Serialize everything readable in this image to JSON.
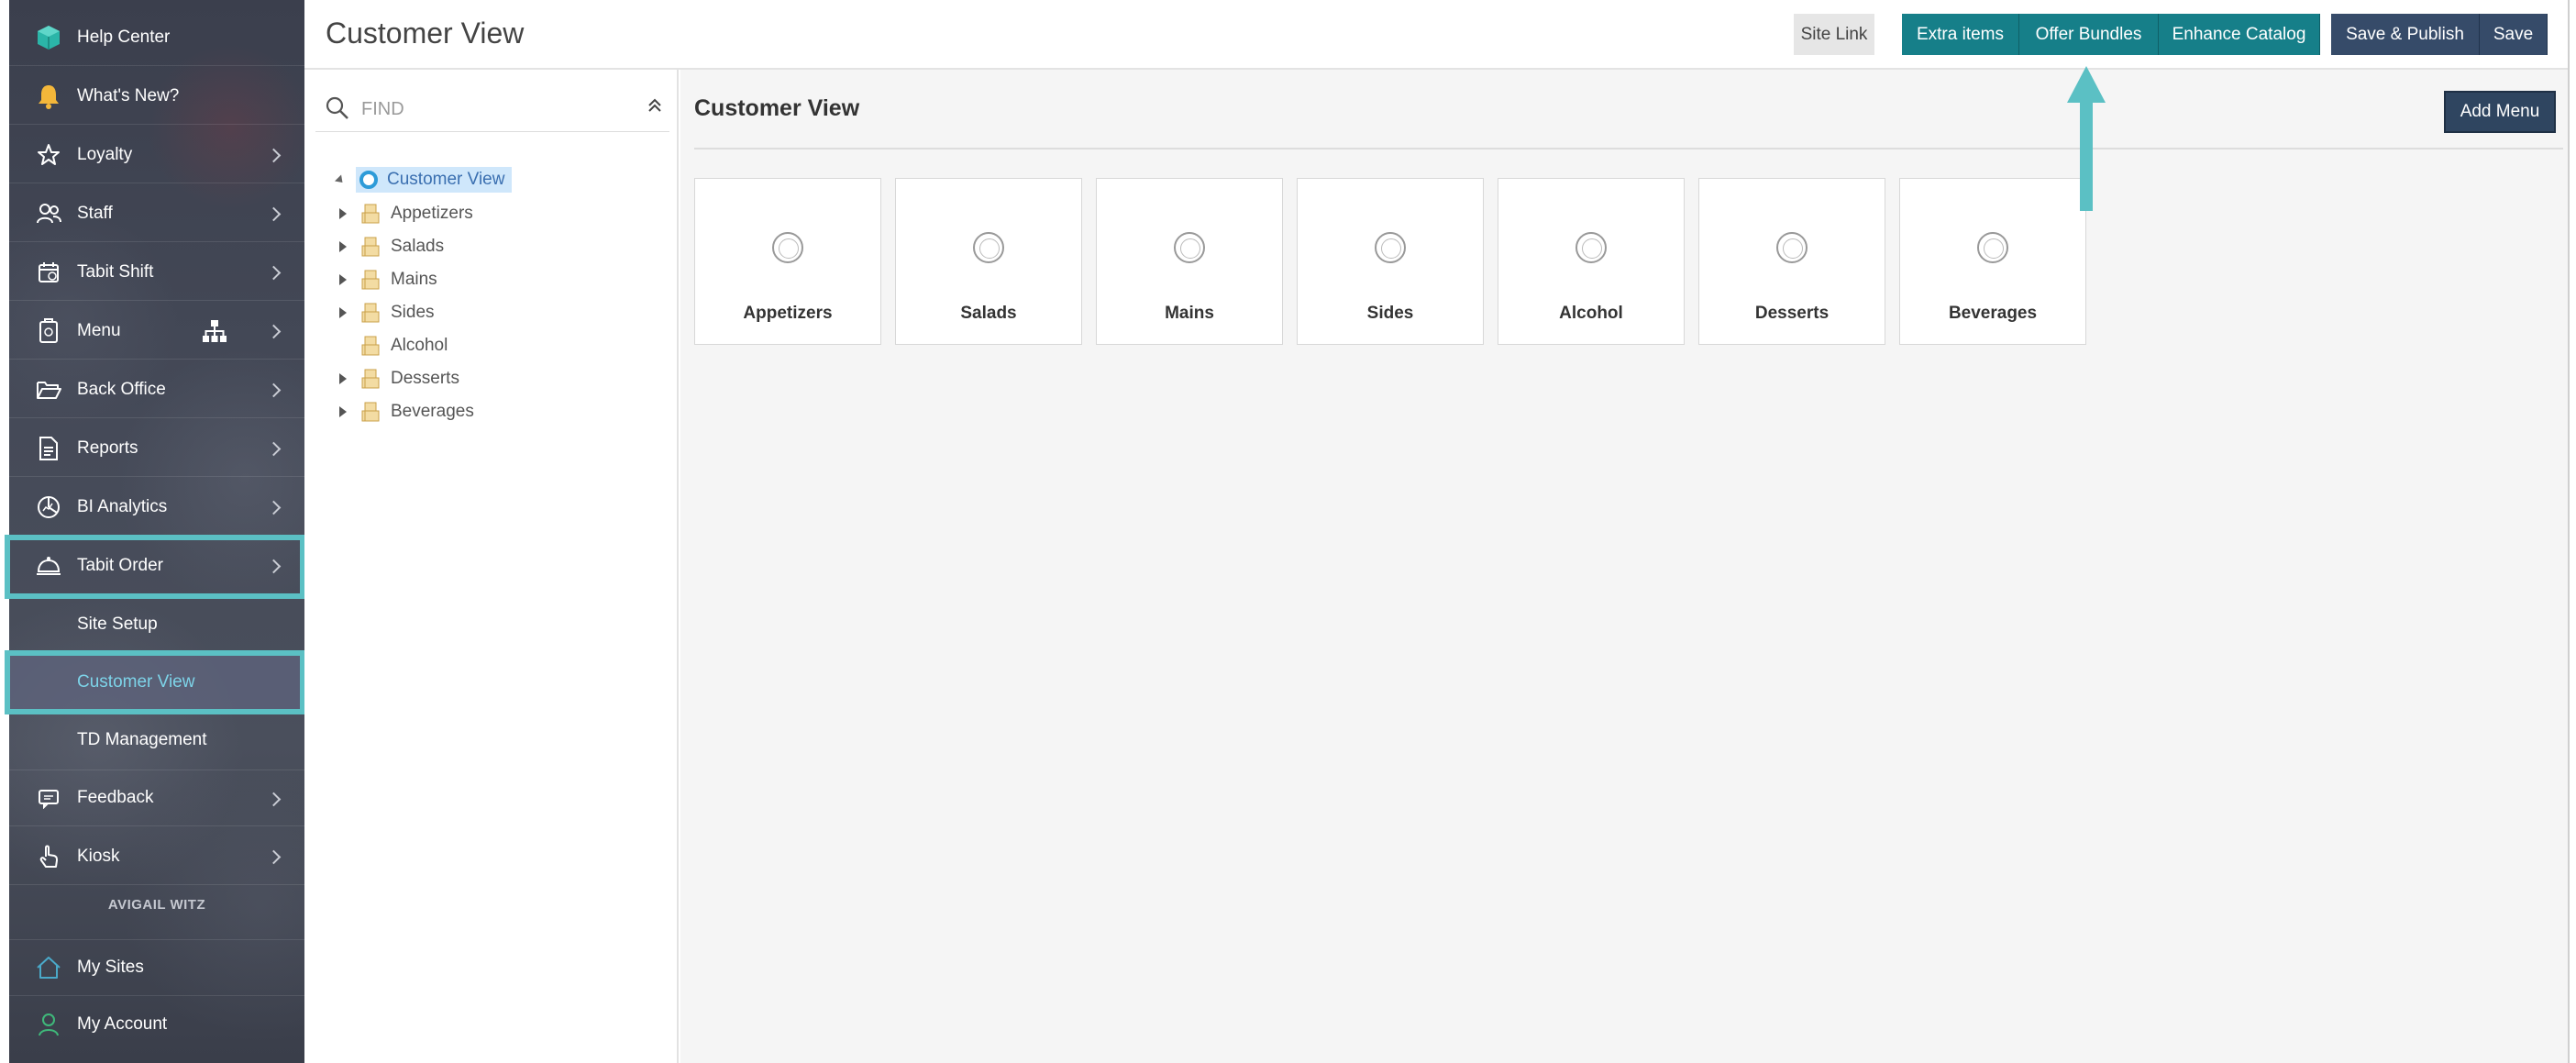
{
  "sidebar": {
    "items": [
      {
        "label": "Help Center",
        "icon": "help-center-icon"
      },
      {
        "label": "What's New?",
        "icon": "bell-icon"
      },
      {
        "label": "Loyalty",
        "icon": "star-icon"
      },
      {
        "label": "Staff",
        "icon": "staff-icon"
      },
      {
        "label": "Tabit Shift",
        "icon": "calendar-icon"
      },
      {
        "label": "Menu",
        "icon": "menu-icon"
      },
      {
        "label": "Back Office",
        "icon": "folder-open-icon"
      },
      {
        "label": "Reports",
        "icon": "report-icon"
      },
      {
        "label": "BI Analytics",
        "icon": "analytics-icon"
      },
      {
        "label": "Tabit Order",
        "icon": "cloche-icon"
      }
    ],
    "sub_items": [
      "Site Setup",
      "Customer View",
      "TD Management"
    ],
    "items_after": [
      {
        "label": "Feedback",
        "icon": "feedback-icon"
      },
      {
        "label": "Kiosk",
        "icon": "touch-icon"
      }
    ],
    "user_name": "AVIGAIL WITZ",
    "bottom": [
      {
        "label": "My Sites",
        "icon": "home-icon"
      },
      {
        "label": "My Account",
        "icon": "account-icon"
      }
    ]
  },
  "header": {
    "title": "Customer View",
    "buttons": {
      "site_link": "Site Link",
      "extra_items": "Extra items",
      "offer_bundles": "Offer Bundles",
      "enhance_catalog": "Enhance Catalog",
      "save_publish": "Save & Publish",
      "save": "Save"
    }
  },
  "tree": {
    "find_placeholder": "FIND",
    "root": "Customer View",
    "nodes": [
      "Appetizers",
      "Salads",
      "Mains",
      "Sides",
      "Alcohol",
      "Desserts",
      "Beverages"
    ]
  },
  "main": {
    "title": "Customer View",
    "add_menu": "Add Menu",
    "cards": [
      "Appetizers",
      "Salads",
      "Mains",
      "Sides",
      "Alcohol",
      "Desserts",
      "Beverages"
    ]
  },
  "colors": {
    "teal": "#167f89",
    "navy": "#364b69",
    "highlight": "#5bc0c4",
    "selection": "#cfe7fb"
  }
}
